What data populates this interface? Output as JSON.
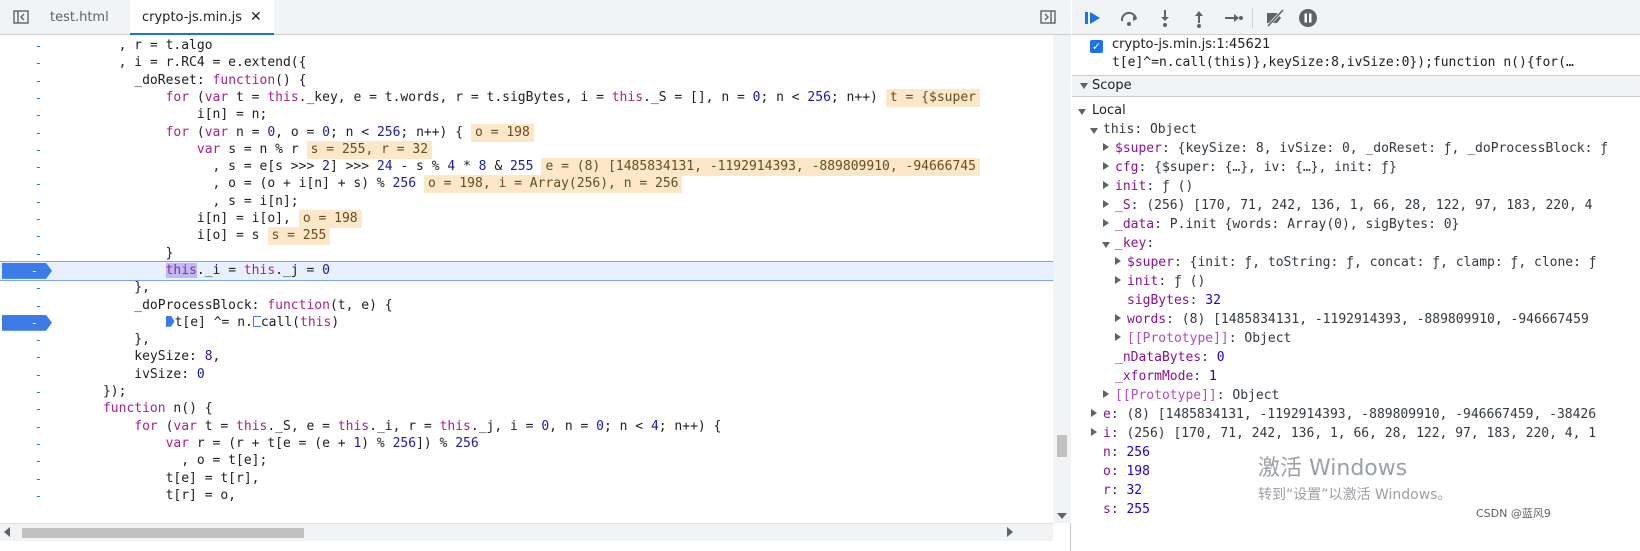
{
  "tabs": {
    "items": [
      {
        "label": "test.html"
      },
      {
        "label": "crypto-js.min.js",
        "close": "✕"
      }
    ]
  },
  "editor": {
    "gutter_dash": "-",
    "lines": [
      {
        "code": "        , r = t.algo"
      },
      {
        "code": "        , i = r.RC4 = e.extend({"
      },
      {
        "code": "          _doReset: function() {"
      },
      {
        "code": "              for (var t = this._key, e = t.words, r = t.sigBytes, i = this._S = [], n = 0; n < 256; n++)",
        "inline": "t = {$super"
      },
      {
        "code": "                  i[n] = n;"
      },
      {
        "code": "              for (var n = 0, o = 0; n < 256; n++) {",
        "inline": "o = 198"
      },
      {
        "code": "                  var s = n % r",
        "inline": "s = 255, r = 32"
      },
      {
        "code": "                    , s = e[s >>> 2] >>> 24 - s % 4 * 8 & 255",
        "inline": "e = (8) [1485834131, -1192914393, -889809910, -94666745"
      },
      {
        "code": "                    , o = (o + i[n] + s) % 256",
        "inline": "o = 198, i = Array(256), n = 256"
      },
      {
        "code": "                    , s = i[n];"
      },
      {
        "code": "                  i[n] = i[o],",
        "inline": "o = 198"
      },
      {
        "code": "                  i[o] = s",
        "inline": "s = 255"
      },
      {
        "code": "              }"
      },
      {
        "code_pre": "              ",
        "code_sel": "this",
        "code": "._i = this._j = 0"
      },
      {
        "code": "          },"
      },
      {
        "code": "          _doProcessBlock: function(t, e) {"
      },
      {
        "code_a": "t[e] ^= n.",
        "code_b": "call(this)"
      },
      {
        "code": "          },"
      },
      {
        "code": "          keySize: 8,"
      },
      {
        "code": "          ivSize: 0"
      },
      {
        "code": "      });"
      },
      {
        "code": "      function n() {"
      },
      {
        "code": "          for (var t = this._S, e = this._i, r = this._j, i = 0, n = 0; n < 4; n++) {"
      },
      {
        "code": "              var r = (r + t[e = (e + 1) % 256]) % 256"
      },
      {
        "code": "                , o = t[e];"
      },
      {
        "code": "              t[e] = t[r],"
      },
      {
        "code": "              t[r] = o,"
      }
    ]
  },
  "breakpoint": {
    "location": "crypto-js.min.js:1:45621",
    "snippet": "t[e]^=n.call(this)},keySize:8,ivSize:0});function n(){for(…"
  },
  "scope": {
    "header": "Scope",
    "local_label": "Local",
    "rows": [
      {
        "indent": 1,
        "tw": "d",
        "key": "this",
        "val": "Object",
        "kc": "plain"
      },
      {
        "indent": 2,
        "tw": "r",
        "key": "$super",
        "val": "{keySize: 8, ivSize: 0, _doReset: ƒ, _doProcessBlock: ƒ"
      },
      {
        "indent": 2,
        "tw": "r",
        "key": "cfg",
        "val": "{$super: {…}, iv: {…}, init: ƒ}"
      },
      {
        "indent": 2,
        "tw": "r",
        "key": "init",
        "val": "ƒ ()"
      },
      {
        "indent": 2,
        "tw": "r",
        "key": "_S",
        "val": "(256) [170, 71, 242, 136, 1, 66, 28, 122, 97, 183, 220, 4"
      },
      {
        "indent": 2,
        "tw": "r",
        "key": "_data",
        "val": "P.init {words: Array(0), sigBytes: 0}"
      },
      {
        "indent": 2,
        "tw": "d",
        "key": "_key",
        "val": ""
      },
      {
        "indent": 3,
        "tw": "r",
        "key": "$super",
        "val": "{init: ƒ, toString: ƒ, concat: ƒ, clamp: ƒ, clone: ƒ"
      },
      {
        "indent": 3,
        "tw": "r",
        "key": "init",
        "val": "ƒ ()"
      },
      {
        "indent": 3,
        "tw": "",
        "key": "sigBytes",
        "val": "32",
        "vc": "num"
      },
      {
        "indent": 3,
        "tw": "r",
        "key": "words",
        "val": "(8) [1485834131, -1192914393, -889809910, -946667459"
      },
      {
        "indent": 3,
        "tw": "r",
        "key": "[[Prototype]]",
        "val": "Object",
        "kc": "dim"
      },
      {
        "indent": 2,
        "tw": "",
        "key": "_nDataBytes",
        "val": "0",
        "vc": "num"
      },
      {
        "indent": 2,
        "tw": "",
        "key": "_xformMode",
        "val": "1",
        "vc": "num"
      },
      {
        "indent": 2,
        "tw": "r",
        "key": "[[Prototype]]",
        "val": "Object",
        "kc": "dim"
      },
      {
        "indent": 1,
        "tw": "r",
        "key": "e",
        "val": "(8) [1485834131, -1192914393, -889809910, -946667459, -38426"
      },
      {
        "indent": 1,
        "tw": "r",
        "key": "i",
        "val": "(256) [170, 71, 242, 136, 1, 66, 28, 122, 97, 183, 220, 4, 1"
      },
      {
        "indent": 1,
        "tw": "",
        "key": "n",
        "val": "256",
        "vc": "num"
      },
      {
        "indent": 1,
        "tw": "",
        "key": "o",
        "val": "198",
        "vc": "num"
      },
      {
        "indent": 1,
        "tw": "",
        "key": "r",
        "val": "32",
        "vc": "num"
      },
      {
        "indent": 1,
        "tw": "",
        "key": "s",
        "val": "255",
        "vc": "num"
      }
    ]
  },
  "watermark": {
    "line1": "激活 Windows",
    "line2": "转到“设置”以激活 Windows。"
  },
  "credit": "CSDN @蓝风9",
  "colors": {
    "accent": "#1a73e8",
    "breakpoint": "#3c7be8",
    "inline_value_bg": "#fde7c9",
    "keyword": "#a9238c"
  }
}
